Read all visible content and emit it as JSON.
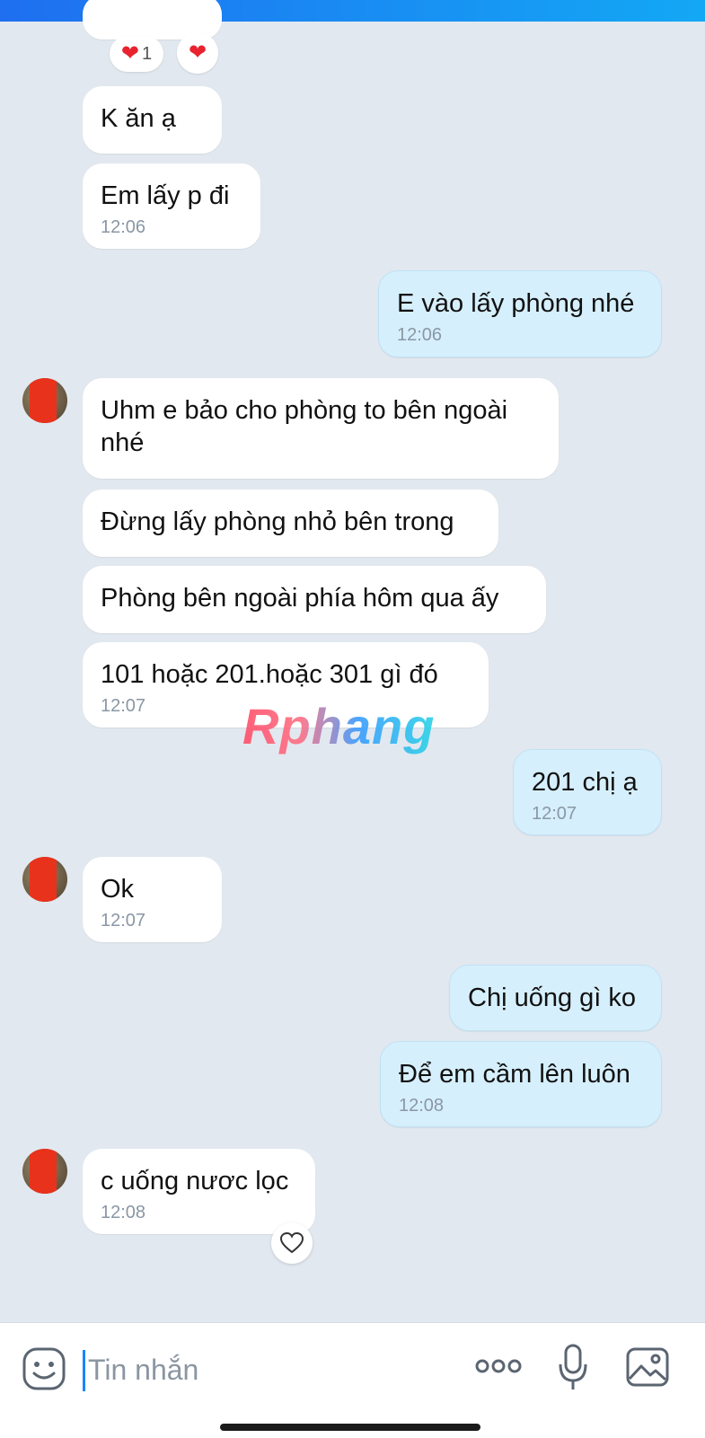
{
  "messages": [
    {
      "side": "in",
      "text": "K ăn ạ",
      "time": ""
    },
    {
      "side": "in",
      "text": "Em lấy p đi",
      "time": "12:06"
    },
    {
      "side": "out",
      "text": "E vào lấy phòng nhé",
      "time": "12:06"
    },
    {
      "side": "in",
      "text": "Uhm e bảo cho phòng to bên ngoài nhé",
      "time": ""
    },
    {
      "side": "in",
      "text": "Đừng lấy phòng nhỏ bên trong",
      "time": ""
    },
    {
      "side": "in",
      "text": "Phòng bên ngoài phía hôm qua ấy",
      "time": ""
    },
    {
      "side": "in",
      "text": "101 hoặc 201.hoặc 301 gì đó",
      "time": "12:07"
    },
    {
      "side": "out",
      "text": "201 chị ạ",
      "time": "12:07"
    },
    {
      "side": "in",
      "text": "Ok",
      "time": "12:07"
    },
    {
      "side": "out",
      "text": "Chị uống gì ko",
      "time": ""
    },
    {
      "side": "out",
      "text": "Để em cầm lên luôn",
      "time": "12:08"
    },
    {
      "side": "in",
      "text": "c uống nươc lọc",
      "time": "12:08"
    }
  ],
  "reactions": {
    "count": "1"
  },
  "watermark": "Rphang",
  "input": {
    "placeholder": "Tin nhắn"
  },
  "icons": [
    "heart-icon",
    "like-heart-icon",
    "sticker-icon",
    "more-icon",
    "microphone-icon",
    "image-icon"
  ],
  "colors": {
    "incoming": "#ffffff",
    "outgoing": "#d6effc",
    "background": "#e2e8ef",
    "accent": "#1b84ff"
  }
}
